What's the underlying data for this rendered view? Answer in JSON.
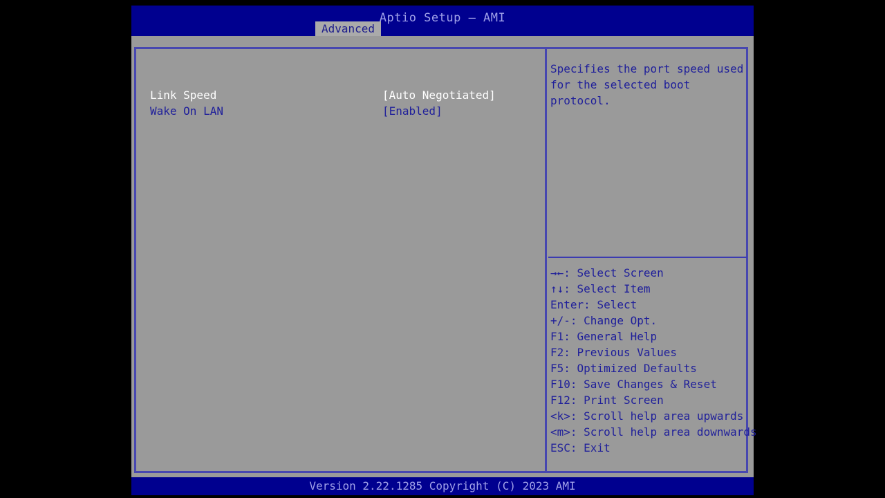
{
  "window": {
    "title": "Aptio Setup – AMI",
    "background_color": "#000000",
    "header_color": "#00008f",
    "body_color": "#9a9a9a",
    "border_color": "#4747b0",
    "text_color": "#20209a",
    "selected_text_color": "#ffffff",
    "header_text_color": "#9fa0e8"
  },
  "menubar": {
    "tabs": [
      {
        "label": "Advanced",
        "active": true
      }
    ]
  },
  "options": [
    {
      "label": "Link Speed",
      "value": "[Auto Negotiated]",
      "selected": true
    },
    {
      "label": "Wake On LAN",
      "value": "[Enabled]",
      "selected": false
    }
  ],
  "help": {
    "text": "Specifies the port speed used for the selected boot protocol."
  },
  "legend": [
    {
      "key": "→←",
      "text": ": Select Screen"
    },
    {
      "key": "↑↓",
      "text": ": Select Item"
    },
    {
      "key": "Enter",
      "text": ": Select"
    },
    {
      "key": "+/-",
      "text": ": Change Opt."
    },
    {
      "key": "F1",
      "text": ": General Help"
    },
    {
      "key": "F2",
      "text": ": Previous Values"
    },
    {
      "key": "F5",
      "text": ": Optimized Defaults"
    },
    {
      "key": "F10",
      "text": ": Save Changes & Reset"
    },
    {
      "key": "F12",
      "text": ": Print Screen"
    },
    {
      "key": "<k>",
      "text": ": Scroll help area upwards"
    },
    {
      "key": "<m>",
      "text": ": Scroll help area downwards"
    },
    {
      "key": "ESC",
      "text": ": Exit"
    }
  ],
  "footer": {
    "version": "Version 2.22.1285 Copyright (C) 2023 AMI"
  }
}
